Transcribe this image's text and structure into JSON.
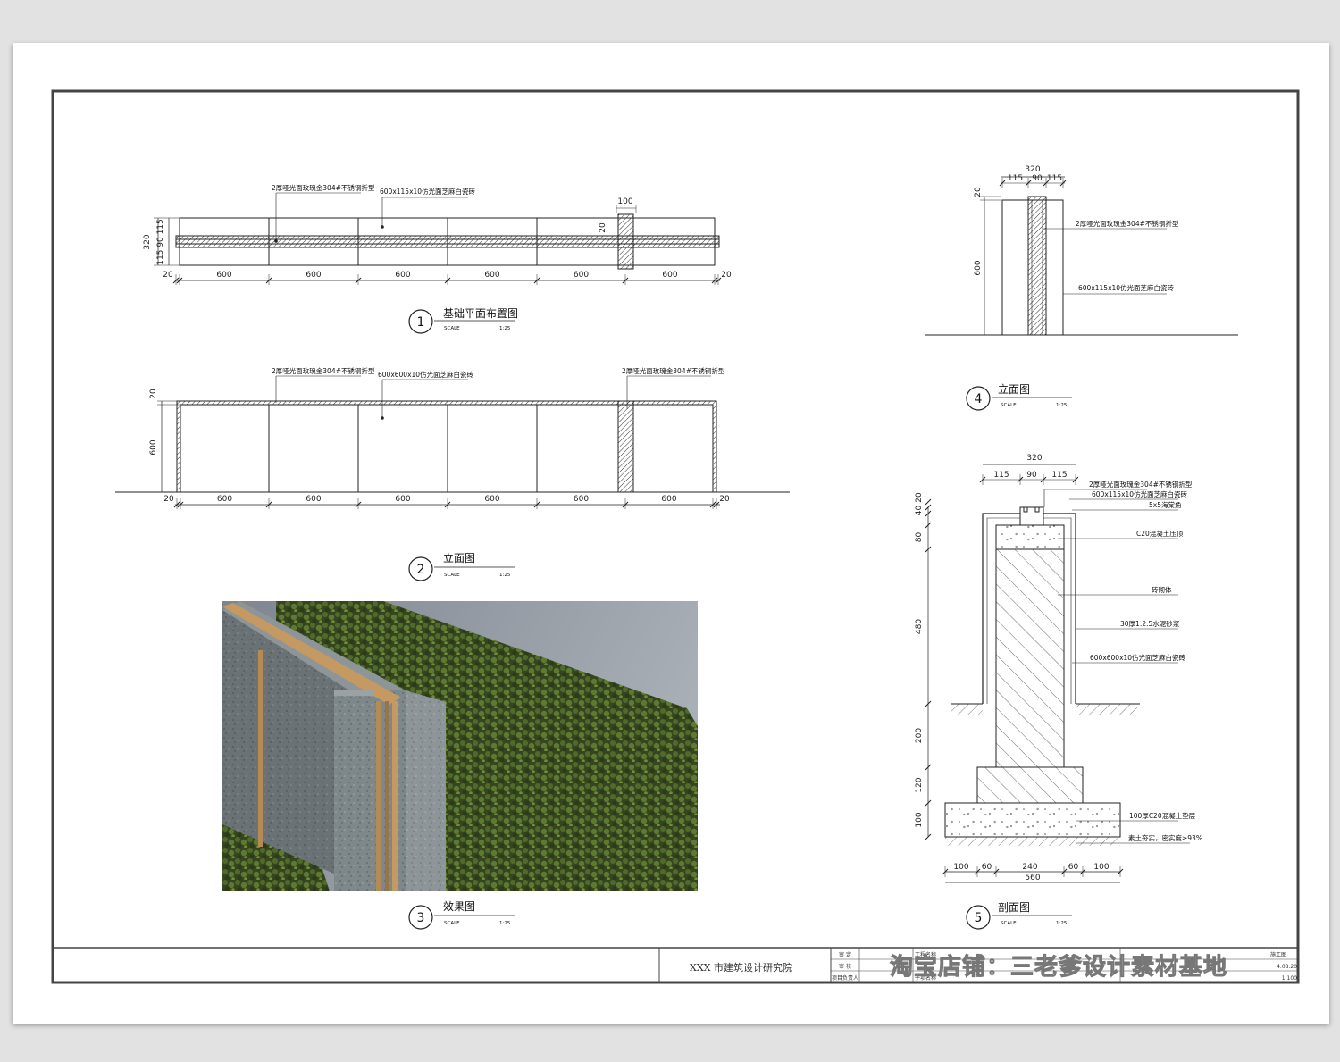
{
  "drawings": {
    "plan": {
      "number": "1",
      "title": "基础平面布置图",
      "scale_label": "SCALE",
      "scale_value": "1:25",
      "callout_steel": "2厚哑光面玫瑰金304#不锈钢折型",
      "callout_tile": "600x115x10仿光面芝麻白瓷砖",
      "dim_top": "100",
      "dim_gap": "20",
      "dim_height_total": "320",
      "dim_height_parts": "115 90 115",
      "dim_bottom": [
        "20",
        "600",
        "600",
        "600",
        "600",
        "600",
        "600",
        "20"
      ]
    },
    "elevation": {
      "number": "2",
      "title": "立面图",
      "scale_label": "SCALE",
      "scale_value": "1:25",
      "callout_steel_left": "2厚哑光面玫瑰金304#不锈钢折型",
      "callout_tile": "600x600x10仿光面芝麻白瓷砖",
      "callout_steel_right": "2厚哑光面玫瑰金304#不锈钢折型",
      "dim_top": "20",
      "dim_height": "600",
      "dim_bottom": [
        "20",
        "600",
        "600",
        "600",
        "600",
        "600",
        "600",
        "20"
      ]
    },
    "effect": {
      "number": "3",
      "title": "效果图",
      "scale_label": "SCALE",
      "scale_value": "1:25"
    },
    "side_elevation": {
      "number": "4",
      "title": "立面图",
      "scale_label": "SCALE",
      "scale_value": "1:25",
      "dim_total": "320",
      "dim_parts": [
        "115",
        "90",
        "115"
      ],
      "dim_top": "20",
      "dim_height": "600",
      "callout_steel": "2厚哑光面玫瑰金304#不锈钢折型",
      "callout_tile": "600x115x10仿光面芝麻白瓷砖"
    },
    "section": {
      "number": "5",
      "title": "剖面图",
      "scale_label": "SCALE",
      "scale_value": "1:25",
      "dim_total": "320",
      "dim_parts": [
        "115",
        "90",
        "115"
      ],
      "dim_left": [
        "20",
        "40",
        "80",
        "480",
        "200",
        "120",
        "100"
      ],
      "dim_bottom": [
        "100",
        "60",
        "240",
        "60",
        "100"
      ],
      "dim_bottom_total": "560",
      "callouts": [
        "2厚哑光面玫瑰金304#不锈钢折型",
        "600x115x10仿光面芝麻白瓷砖",
        "5x5海棠角",
        "C20混凝土压顶",
        "砖砌体",
        "30厚1:2.5水泥砂浆",
        "600x600x10仿光面芝麻白瓷砖",
        "100厚C20混凝土垫层",
        "素土夯实，密实度≥93%"
      ]
    }
  },
  "title_block": {
    "company": "XXX 市建筑设计研究院",
    "row_labels": [
      "审 定",
      "审 核",
      "项目负责人"
    ],
    "col2_labels": [
      "工程名称",
      "子项名称"
    ],
    "right_labels": [
      "施工图",
      "4.08.20",
      "1:100"
    ],
    "watermark": "淘宝店铺：三老爹设计素材基地"
  },
  "colors": {
    "line": "#222222",
    "frame": "#444444",
    "bronze": "#b58a55"
  }
}
